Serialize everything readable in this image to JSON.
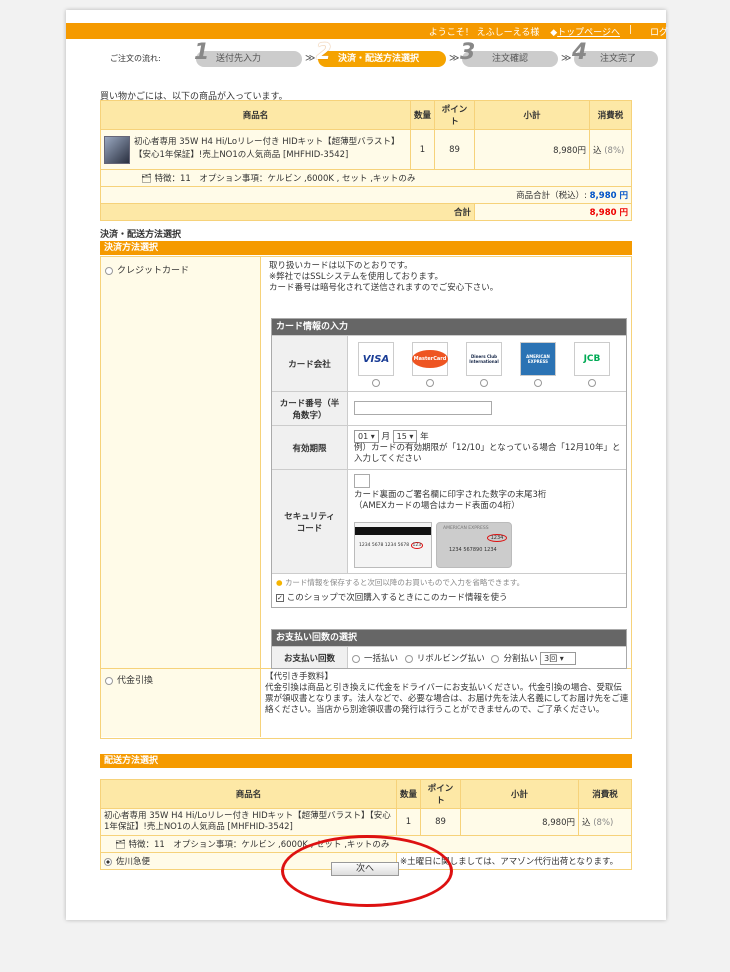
{
  "header": {
    "welcome": "ようこそ！ えふしーえる様",
    "top_link": "トップページへ",
    "separator": "|",
    "cut_text": "ログ"
  },
  "steps": {
    "label": "ご注文の流れ:",
    "items": [
      {
        "num": "1",
        "label": "送付先入力"
      },
      {
        "num": "2",
        "label": "決済・配送方法選択"
      },
      {
        "num": "3",
        "label": "注文確認"
      },
      {
        "num": "4",
        "label": "注文完了"
      }
    ],
    "arrow": "≫"
  },
  "cart": {
    "intro": "買い物かごには、以下の商品が入っています。",
    "headers": [
      "商品名",
      "数量",
      "ポイント",
      "小計",
      "消費税"
    ],
    "product_name": "初心者専用 35W H4 Hi/Loリレー付き HIDキット【超薄型バラスト】【安心1年保証】!売上NO1の人気商品 [MHFHID-3542]",
    "qty": "1",
    "points": "89",
    "subtotal": "8,980円",
    "tax_label": "込",
    "tax_rate": "(8%)",
    "options": "特徴：11　オプション事項：ケルビン ,6000K , セット ,キットのみ",
    "goods_total_label": "商品合計（税込）:",
    "goods_total": "8,980 円",
    "total_label": "合計",
    "total": "8,980 円"
  },
  "payment": {
    "section_label": "決済・配送方法選択",
    "bar": "決済方法選択",
    "credit_label": "クレジットカード",
    "credit_info": [
      "取り扱いカードは以下のとおりです。",
      "※弊社ではSSLシステムを使用しております。",
      "カード番号は暗号化されて送信されますのでご安心下さい。"
    ],
    "card_input_header": "カード情報の入力",
    "card_company_label": "カード会社",
    "card_logos": [
      "VISA",
      "MasterCard",
      "Diners Club International",
      "AMERICAN EXPRESS",
      "JCB"
    ],
    "card_number_label": "カード番号（半角数字）",
    "expiry_label": "有効期限",
    "expiry_month": "01",
    "expiry_month_unit": "月",
    "expiry_year": "15",
    "expiry_year_unit": "年",
    "expiry_note": "例）カードの有効期限が「12/10」となっている場合「12月10年」と入力してください",
    "security_label": "セキュリティコード",
    "security_note1": "カード裏面のご署名欄に印字された数字の末尾3桁",
    "security_note2": "（AMEXカードの場合はカード表面の4桁）",
    "sample_card1_number": "1234 5678 1234 5678",
    "sample_card1_code": "123",
    "sample_card2_brand": "AMERICAN EXPRESS",
    "sample_card2_code": "1234",
    "sample_card2_number": "1234 567890 1234",
    "save_hint": "カード情報を保存すると次回以降のお買いもので入力を省略できます。",
    "save_check": "このショップで次回購入するときにこのカード情報を使う",
    "installments_header": "お支払い回数の選択",
    "installments_label": "お支払い回数",
    "installment_options": [
      "一括払い",
      "リボルビング払い",
      "分割払い"
    ],
    "installment_count": "3回",
    "cod_label": "代金引換",
    "cod_title": "【代引き手数料】",
    "cod_text": "代金引換は商品と引き換えに代金をドライバーにお支払いください。代金引換の場合、受取伝票が領収書となります。法人などで、必要な場合は、お届け先を法人名義にしてお届け先をご連絡ください。当店から別途領収書の発行は行うことができませんので、ご了承ください。"
  },
  "delivery": {
    "bar": "配送方法選択",
    "headers": [
      "商品名",
      "数量",
      "ポイント",
      "小計",
      "消費税"
    ],
    "product_name": "初心者専用 35W H4 Hi/Loリレー付き HIDキット【超薄型バラスト】【安心1年保証】!売上NO1の人気商品 [MHFHID-3542]",
    "qty": "1",
    "points": "89",
    "subtotal": "8,980円",
    "tax_label": "込",
    "tax_rate": "(8%)",
    "options": "特徴：11　オプション事項：ケルビン ,6000K , セット ,キットのみ",
    "carrier": "佐川急便",
    "carrier_note": "※土曜日に関しましては、アマゾン代行出荷となります。"
  },
  "next_button": "次へ"
}
